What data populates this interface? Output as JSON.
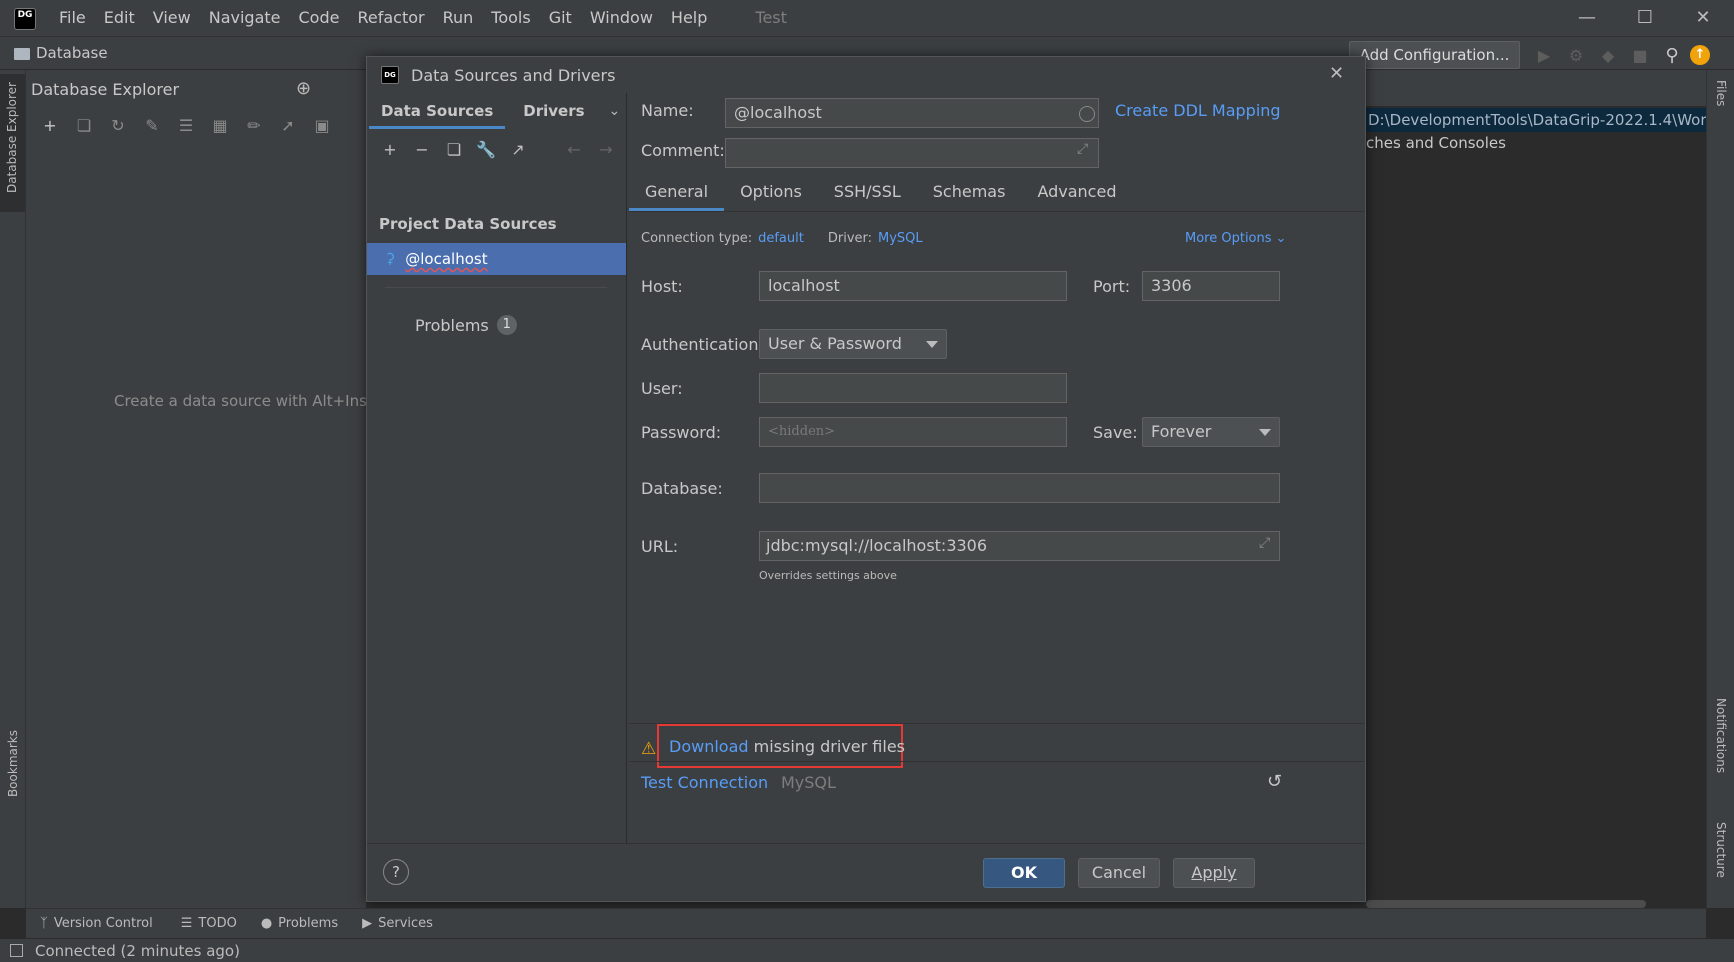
{
  "menu": [
    "File",
    "Edit",
    "View",
    "Navigate",
    "Code",
    "Refactor",
    "Run",
    "Tools",
    "Git",
    "Window",
    "Help"
  ],
  "project_name": "Test",
  "logo_text": "DG",
  "navbar": {
    "crumb": "Database",
    "add_configuration": "Add Configuration..."
  },
  "left_stripe": {
    "database_explorer": "Database Explorer",
    "bookmarks": "Bookmarks"
  },
  "right_stripe": {
    "files": "Files",
    "notifications": "Notifications",
    "structure": "Structure"
  },
  "explorer": {
    "title": "Database Explorer",
    "empty_hint": "Create a data source with Alt+Inser"
  },
  "editor": {
    "path": "D:\\DevelopmentTools\\DataGrip-2022.1.4\\Wor",
    "consoles": "ches and Consoles"
  },
  "dialog": {
    "title": "Data Sources and Drivers",
    "left_tabs": [
      "Data Sources",
      "Drivers"
    ],
    "section": "Project Data Sources",
    "selected_source": "@localhost",
    "problems_label": "Problems",
    "problems_count": "1",
    "name_label": "Name:",
    "name_value": "@localhost",
    "create_ddl": "Create DDL Mapping",
    "comment_label": "Comment:",
    "comment_value": "",
    "tabs": [
      "General",
      "Options",
      "SSH/SSL",
      "Schemas",
      "Advanced"
    ],
    "connection_type_label": "Connection type:",
    "connection_type_value": "default",
    "driver_label": "Driver:",
    "driver_value": "MySQL",
    "more_options": "More Options",
    "host_label": "Host:",
    "host_value": "localhost",
    "port_label": "Port:",
    "port_value": "3306",
    "auth_label": "Authentication:",
    "auth_value": "User & Password",
    "user_label": "User:",
    "user_value": "",
    "password_label": "Password:",
    "password_placeholder": "<hidden>",
    "save_label": "Save:",
    "save_value": "Forever",
    "database_label": "Database:",
    "database_value": "",
    "url_label": "URL:",
    "url_value": "jdbc:mysql://localhost:3306",
    "url_note": "Overrides settings above",
    "warning_link": "Download",
    "warning_text": " missing driver files",
    "test_connection": "Test Connection",
    "driver_footer": "MySQL",
    "ok": "OK",
    "cancel": "Cancel",
    "apply": "Apply",
    "help": "?"
  },
  "toolwindows": [
    "Version Control",
    "TODO",
    "Problems",
    "Services"
  ],
  "status": "Connected (2 minutes ago)",
  "colors": {
    "accent": "#4a88c7",
    "selection": "#4b6eaf",
    "link": "#589df6",
    "highlight_box": "#e53935"
  }
}
